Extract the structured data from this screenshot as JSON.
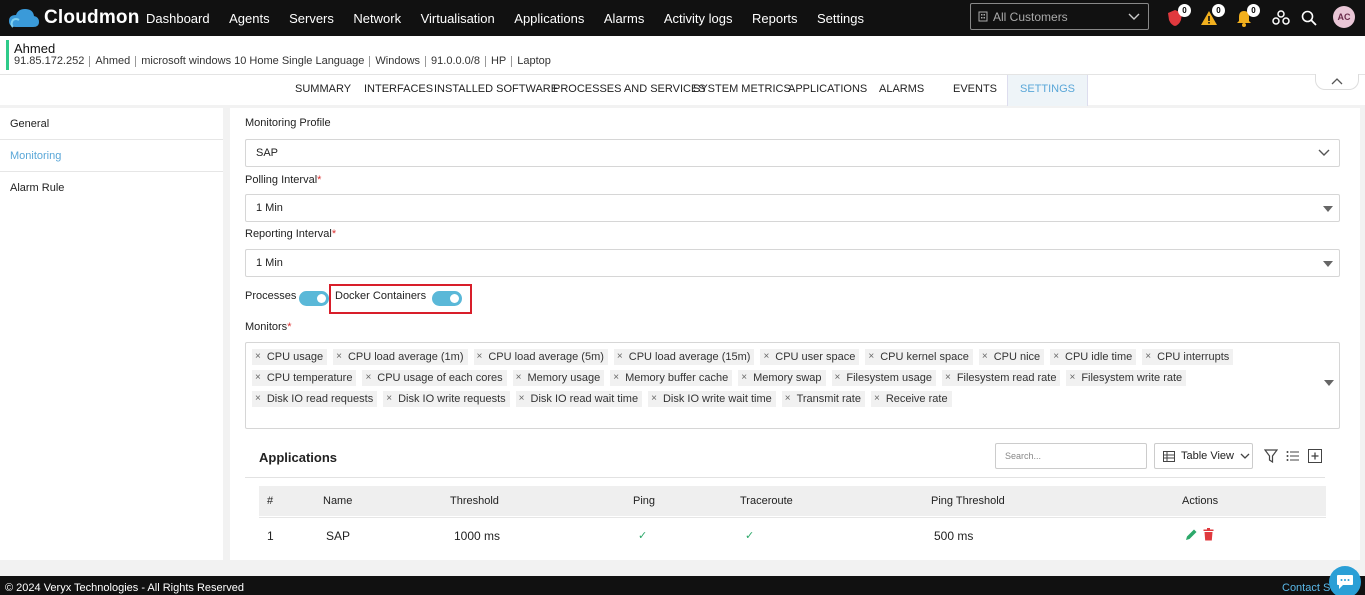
{
  "brand": {
    "name": "Cloudmon"
  },
  "nav": {
    "items": [
      "Dashboard",
      "Agents",
      "Servers",
      "Network",
      "Virtualisation",
      "Applications",
      "Alarms",
      "Activity logs",
      "Reports",
      "Settings"
    ]
  },
  "customer_select": {
    "value": "All Customers"
  },
  "notifications": {
    "security_count": "0",
    "warning_count": "0",
    "bell_count": "0"
  },
  "user": {
    "initials": "AC"
  },
  "device": {
    "name": "Ahmed",
    "ip": "91.85.172.252",
    "owner": "Ahmed",
    "os": "microsoft windows 10 Home Single Language",
    "platform": "Windows",
    "subnet": "91.0.0.0/8",
    "vendor": "HP",
    "type": "Laptop"
  },
  "tabs": [
    "SUMMARY",
    "INTERFACES",
    "INSTALLED SOFTWARE",
    "PROCESSES AND SERVICES",
    "SYSTEM METRICS",
    "APPLICATIONS",
    "ALARMS",
    "EVENTS",
    "SETTINGS"
  ],
  "active_tab": "SETTINGS",
  "left_menu": {
    "items": [
      "General",
      "Monitoring",
      "Alarm Rule"
    ],
    "active": "Monitoring"
  },
  "form": {
    "monitoring_profile": {
      "label": "Monitoring Profile",
      "value": "SAP"
    },
    "polling_interval": {
      "label": "Polling Interval",
      "required": "*",
      "value": "1 Min"
    },
    "reporting_interval": {
      "label": "Reporting Interval",
      "required": "*",
      "value": "1 Min"
    },
    "processes": {
      "label": "Processes",
      "enabled": true
    },
    "docker_containers": {
      "label": "Docker Containers",
      "enabled": true
    },
    "monitors": {
      "label": "Monitors",
      "required": "*",
      "selected": [
        "CPU usage",
        "CPU load average (1m)",
        "CPU load average (5m)",
        "CPU load average (15m)",
        "CPU user space",
        "CPU kernel space",
        "CPU nice",
        "CPU idle time",
        "CPU interrupts",
        "CPU temperature",
        "CPU usage of each cores",
        "Memory usage",
        "Memory buffer cache",
        "Memory swap",
        "Filesystem usage",
        "Filesystem read rate",
        "Filesystem write rate",
        "Disk IO read requests",
        "Disk IO write requests",
        "Disk IO read wait time",
        "Disk IO write wait time",
        "Transmit rate",
        "Receive rate"
      ]
    }
  },
  "applications": {
    "title": "Applications",
    "search_placeholder": "Search...",
    "view_label": "Table View",
    "columns": [
      "#",
      "Name",
      "Threshold",
      "Ping",
      "Traceroute",
      "Ping Threshold",
      "Actions"
    ],
    "rows": [
      {
        "index": "1",
        "name": "SAP",
        "threshold": "1000 ms",
        "ping": "✓",
        "traceroute": "✓",
        "ping_threshold": "500 ms"
      }
    ]
  },
  "footer": {
    "copyright": "© 2024 Veryx Technologies - All Rights Reserved",
    "contact": "Contact Su"
  }
}
